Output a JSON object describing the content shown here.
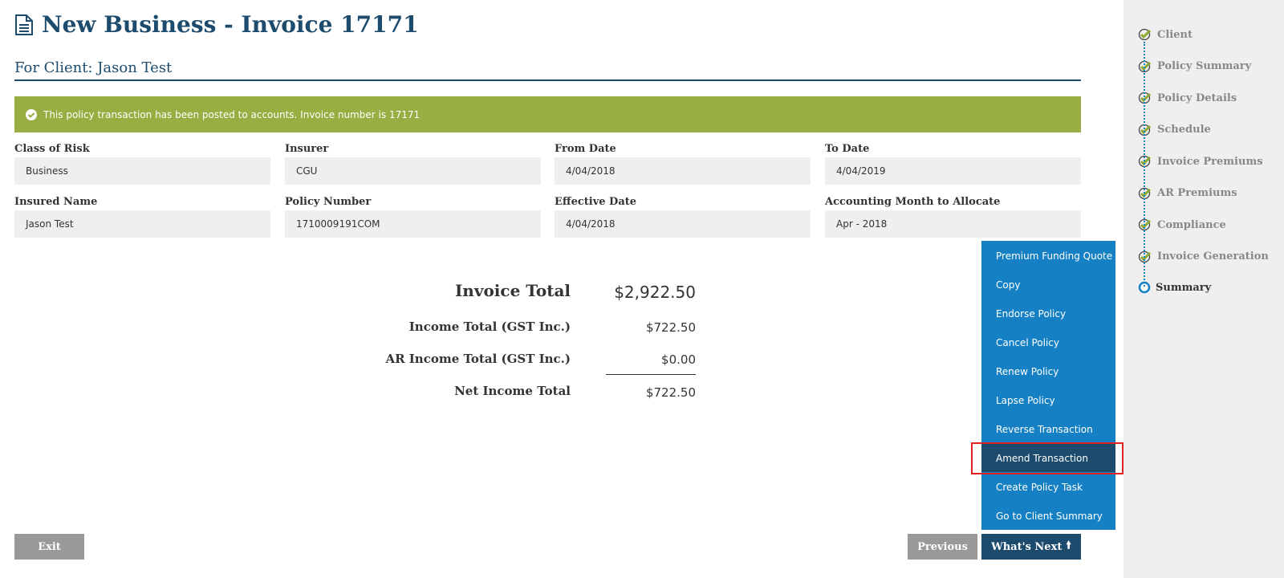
{
  "header": {
    "title": "New Business - Invoice 17171",
    "client": "For Client: Jason Test"
  },
  "alert": {
    "message": "This policy transaction has been posted to accounts. Invoice number is 17171"
  },
  "fields": [
    {
      "label": "Class of Risk",
      "value": "Business"
    },
    {
      "label": "Insurer",
      "value": "CGU"
    },
    {
      "label": "From Date",
      "value": "4/04/2018"
    },
    {
      "label": "To Date",
      "value": "4/04/2019"
    },
    {
      "label": "Insured Name",
      "value": "Jason Test"
    },
    {
      "label": "Policy Number",
      "value": "1710009191COM"
    },
    {
      "label": "Effective Date",
      "value": "4/04/2018"
    },
    {
      "label": "Accounting Month to Allocate",
      "value": "Apr - 2018"
    }
  ],
  "summary": {
    "invoice_total_label": "Invoice Total",
    "invoice_total": "$2,922.50",
    "income_label": "Income Total (GST Inc.)",
    "income": "$722.50",
    "ar_label": "AR Income Total (GST Inc.)",
    "ar": "$0.00",
    "net_label": "Net Income Total",
    "net": "$722.50"
  },
  "menu": [
    "Premium Funding Quote",
    "Copy",
    "Endorse Policy",
    "Cancel Policy",
    "Renew Policy",
    "Lapse Policy",
    "Reverse Transaction",
    "Amend Transaction",
    "Create Policy Task",
    "Go to Client Summary"
  ],
  "buttons": {
    "exit": "Exit",
    "previous": "Previous",
    "whats_next": "What's Next"
  },
  "steps": [
    "Client",
    "Policy Summary",
    "Policy Details",
    "Schedule",
    "Invoice Premiums",
    "AR Premiums",
    "Compliance",
    "Invoice Generation",
    "Summary"
  ]
}
